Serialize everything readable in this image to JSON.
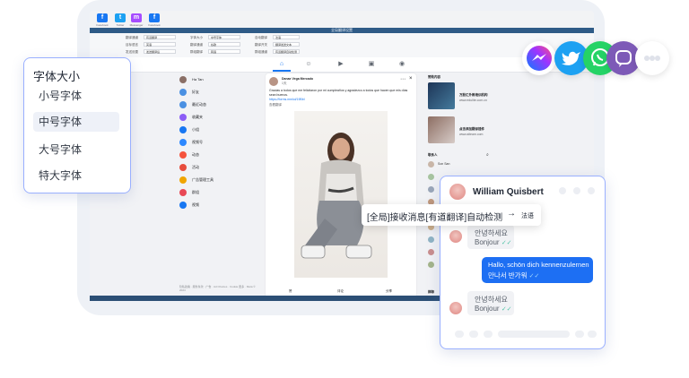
{
  "app": {
    "top_apps": [
      {
        "label": "Facebook",
        "color": "#1877f2",
        "glyph": "f"
      },
      {
        "label": "Twitter",
        "color": "#1da1f2",
        "glyph": "t"
      },
      {
        "label": "Messenger",
        "color": "#a64dff",
        "glyph": "m"
      },
      {
        "label": "Facebook",
        "color": "#1877f2",
        "glyph": "f"
      }
    ],
    "window_title": "全局翻译设置"
  },
  "settings": {
    "rows": [
      [
        {
          "label": "翻译通道",
          "value": "有道翻译"
        },
        {
          "label": "字体大小",
          "value": "中号字体"
        },
        {
          "label": "自动翻译",
          "value": "法语"
        }
      ],
      [
        {
          "label": "目标语言",
          "value": "英语"
        },
        {
          "label": "翻译通道",
          "value": "谷歌"
        },
        {
          "label": "翻译开关",
          "value": "翻译发送文本"
        }
      ],
      [
        {
          "label": "发送设置",
          "value": "发送翻译后"
        },
        {
          "label": "群组翻译",
          "value": "韩语"
        },
        {
          "label": "群组通道",
          "value": "有道翻译自动检测"
        }
      ]
    ]
  },
  "nav": {
    "user": "Ha Tan",
    "items": [
      "视频",
      "广告管理工具",
      "群组",
      "活动",
      "动态",
      "视频号",
      "小组",
      "收藏夹",
      "最近动态",
      "好友"
    ]
  },
  "post": {
    "author": "Danae Vega Mercado",
    "time": "1天",
    "text": "Gracias a todos que me felicitaron por mi cumpleaños y agradezco a todos que hacen que mis días sean buenos.",
    "link": "https://forms.mmlol/19Bbl",
    "see_translation": "查看翻译",
    "actions": [
      "赞",
      "评论",
      "分享"
    ]
  },
  "right": {
    "sponsored_title": "赞助内容",
    "sponsors": [
      {
        "title": "万股汇外教培训机构",
        "url": "www.edulite.com.cn"
      },
      {
        "title": "点击添加翻译插件",
        "url": "www.aiteam.com"
      }
    ],
    "contacts_title": "联系人",
    "contacts": [
      "Son San"
    ],
    "bottom_label": "群聊"
  },
  "footer": "隐私政策 · 服务条款 · 广告 · Ad Choices · Cookie 更多 · Meta © 2024",
  "font_card": {
    "title": "字体大小",
    "options": [
      "小号字体",
      "中号字体",
      "大号字体",
      "特大字体"
    ],
    "selected_index": 1
  },
  "chat": {
    "contact_name": "William Quisbert",
    "messages": [
      {
        "direction": "in",
        "text": "안녕하세요",
        "translation": "Bonjour"
      },
      {
        "direction": "out",
        "text": "Hallo, schön dich kennenzulernen",
        "translation": "만나서 반가워"
      },
      {
        "direction": "in",
        "text": "안녕하세요",
        "translation": "Bonjour"
      }
    ],
    "tooltip": {
      "text": "[全局]接收消息[有道翻译]自动检测",
      "arrow": "→",
      "target": "法语"
    }
  },
  "floating_icons": [
    {
      "name": "messenger",
      "color": "#7b5cff"
    },
    {
      "name": "twitter",
      "color": "#1da1f2"
    },
    {
      "name": "whatsapp",
      "color": "#25d366"
    },
    {
      "name": "viber",
      "color": "#7d5ab7"
    }
  ],
  "colors": {
    "accent": "#1877f2",
    "card_border": "#9ab0ff",
    "bubble_out": "#1d6ff3"
  }
}
